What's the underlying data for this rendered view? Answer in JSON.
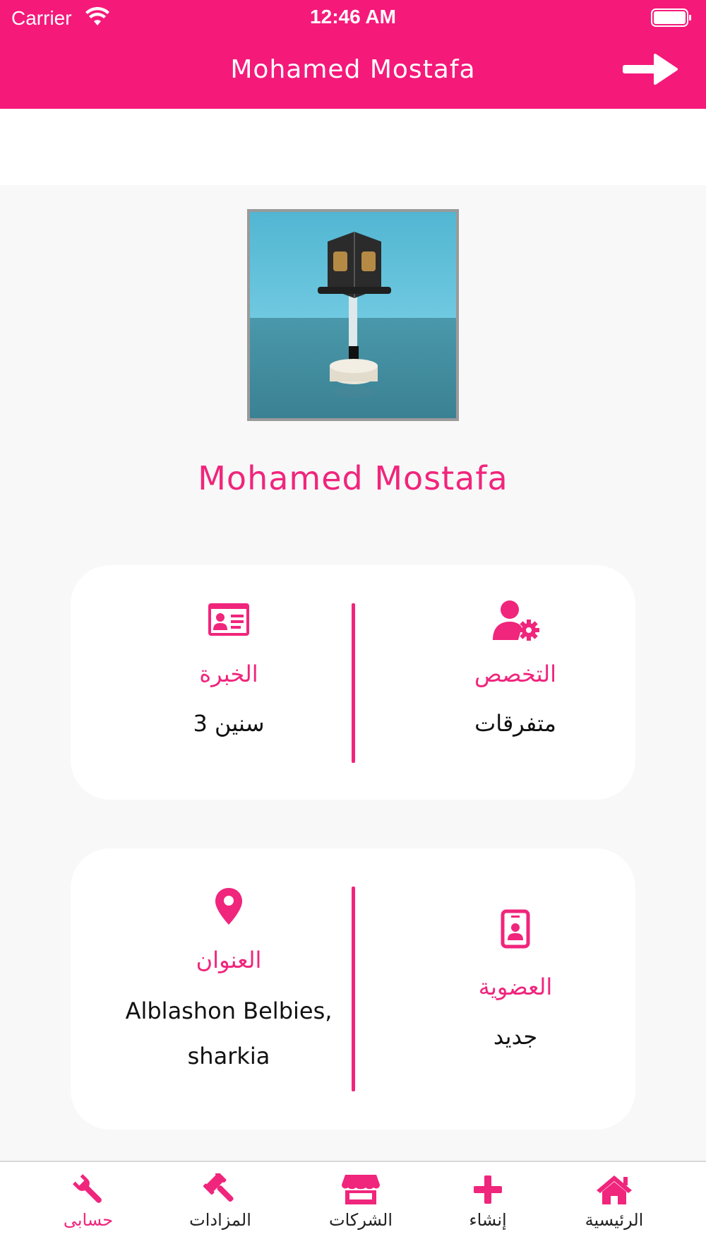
{
  "status_bar": {
    "carrier": "Carrier",
    "time": "12:46 AM"
  },
  "header": {
    "title": "Mohamed Mostafa"
  },
  "profile": {
    "name": "Mohamed Mostafa"
  },
  "info_cards": {
    "specialty": {
      "label": "التخصص",
      "value": "متفرقات"
    },
    "experience": {
      "label": "الخبرة",
      "value": "3 سنين"
    },
    "membership": {
      "label": "العضوية",
      "value": "جديد"
    },
    "address": {
      "label": "العنوان",
      "value_line1": "Alblashon Belbies,",
      "value_line2": "sharkia"
    }
  },
  "tabbar": {
    "items": [
      {
        "label": "الرئيسية",
        "icon": "home-icon"
      },
      {
        "label": "إنشاء",
        "icon": "plus-icon"
      },
      {
        "label": "الشركات",
        "icon": "store-icon"
      },
      {
        "label": "المزادات",
        "icon": "gavel-icon"
      },
      {
        "label": "حسابى",
        "icon": "wrench-icon",
        "active": true
      }
    ]
  },
  "colors": {
    "accent": "#f5197a",
    "text": "#111111",
    "background": "#f8f8f8"
  }
}
